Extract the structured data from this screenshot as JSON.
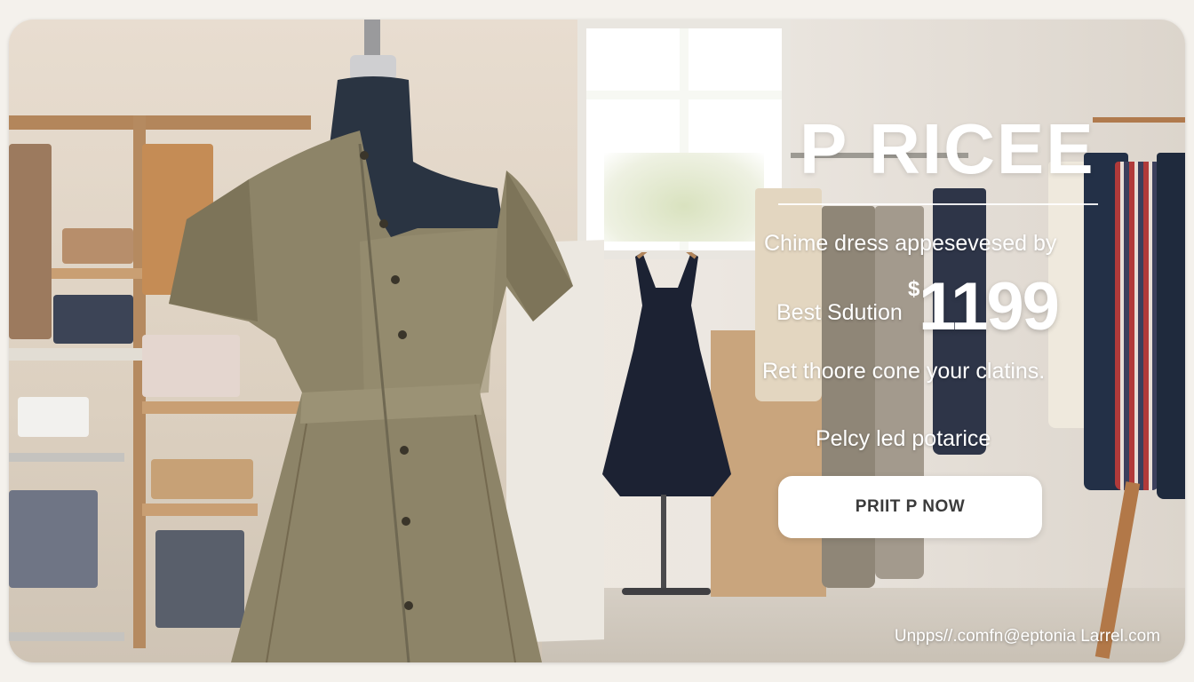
{
  "ad": {
    "headline": "P RICEE",
    "line1": "Chime dress appesevesed by",
    "price_label": "Best Sdution",
    "currency_symbol": "$",
    "price_value": "1199",
    "line2": "Ret thoore cone your clatins.",
    "line3": "Pelcy led potarice",
    "cta_label": "PRIIT P NOW",
    "footer_url": "Unpps//.comfn@eptonia Larrel.com"
  },
  "colors": {
    "text": "#ffffff",
    "button_bg": "#ffffff",
    "button_text": "#3b3b3b",
    "dress": "#8d8468",
    "mannequin": "#2a3442",
    "navy_dress": "#1c2233"
  },
  "scene": {
    "subjects": [
      "mannequin",
      "olive-button-dress",
      "navy-dress-on-stand",
      "clothing-rack",
      "wooden-shelves",
      "window"
    ]
  }
}
